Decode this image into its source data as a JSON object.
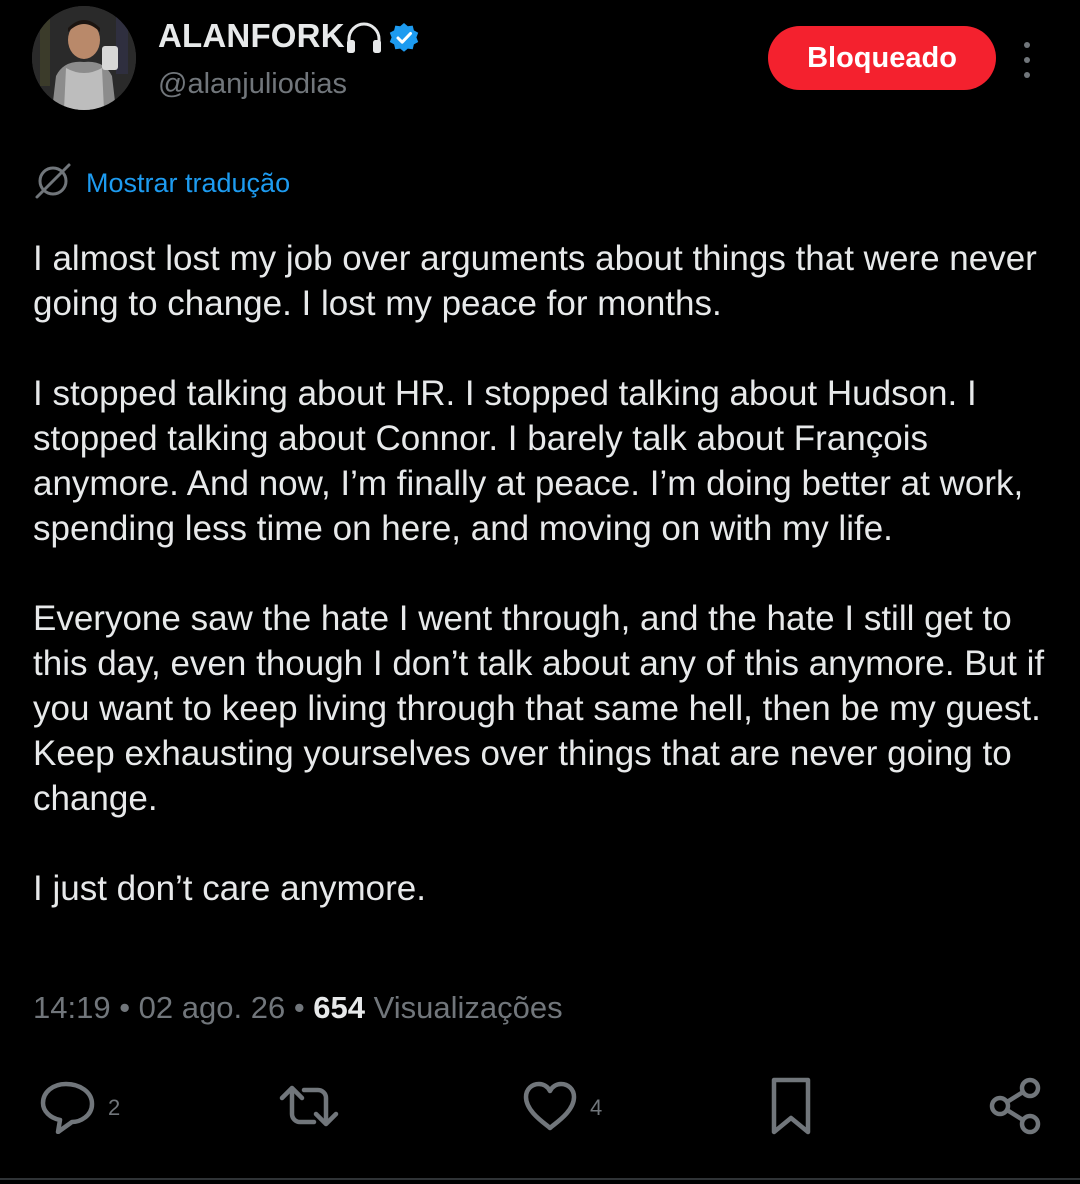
{
  "profile": {
    "display_name": "ALANFORK",
    "handle": "@alanjuliodias",
    "badge_icon": "headphones-icon",
    "verified_icon": "verified-badge-icon",
    "verified_color": "#1d9bf0"
  },
  "header": {
    "blocked_label": "Bloqueado",
    "blocked_color": "#f4212e"
  },
  "translate": {
    "label": "Mostrar tradução",
    "icon": "globe-slash-icon"
  },
  "tweet": {
    "paragraphs": [
      "I almost lost my job over arguments about things that were never going to change. I lost my peace for months.",
      "I stopped talking about HR. I stopped talking about Hudson. I stopped talking about Connor. I barely talk about François anymore. And now, I’m finally at peace. I’m doing better at work, spending less time on here, and moving on with my life.",
      "Everyone saw the hate I went through, and the hate I still get to this day, even though I don’t talk about any of this anymore. But if you want to keep living through that same hell, then be my guest. Keep exhausting yourselves over things that are never going to change.",
      "I just don’t care anymore."
    ],
    "time": "14:19",
    "separator": " • ",
    "date": "02 ago. 26",
    "views_count": "654",
    "views_label": " Visualizações"
  },
  "actions": {
    "reply_count": "2",
    "like_count": "4",
    "icon_color": "#71767b"
  }
}
